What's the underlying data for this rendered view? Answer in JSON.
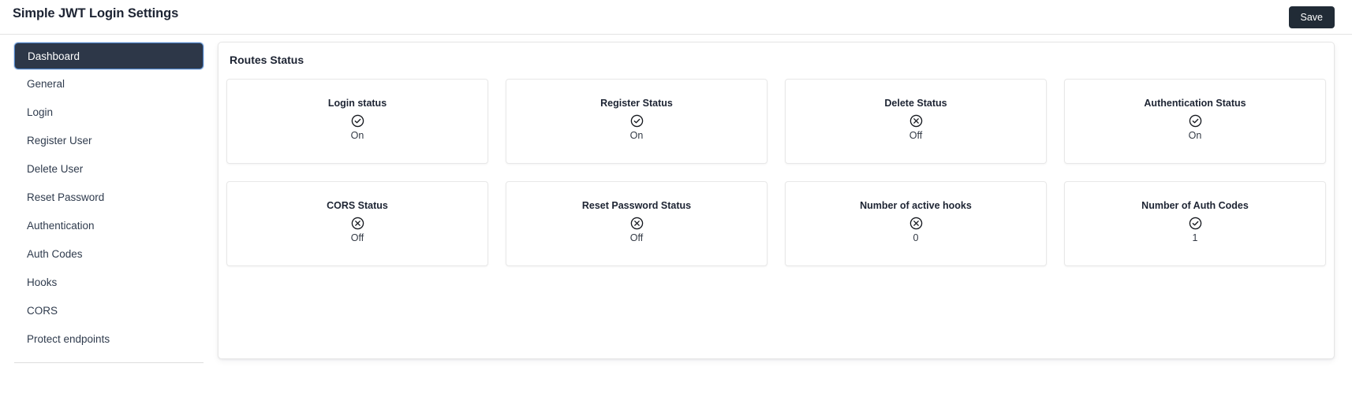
{
  "header": {
    "title": "Simple JWT Login Settings",
    "save_label": "Save"
  },
  "sidebar": {
    "items": [
      {
        "label": "Dashboard",
        "active": true
      },
      {
        "label": "General",
        "active": false
      },
      {
        "label": "Login",
        "active": false
      },
      {
        "label": "Register User",
        "active": false
      },
      {
        "label": "Delete User",
        "active": false
      },
      {
        "label": "Reset Password",
        "active": false
      },
      {
        "label": "Authentication",
        "active": false
      },
      {
        "label": "Auth Codes",
        "active": false
      },
      {
        "label": "Hooks",
        "active": false
      },
      {
        "label": "CORS",
        "active": false
      },
      {
        "label": "Protect endpoints",
        "active": false
      }
    ]
  },
  "main": {
    "panel_title": "Routes Status",
    "cards": [
      {
        "label": "Login status",
        "value": "On",
        "icon": "check-circle-icon"
      },
      {
        "label": "Register Status",
        "value": "On",
        "icon": "check-circle-icon"
      },
      {
        "label": "Delete Status",
        "value": "Off",
        "icon": "x-circle-icon"
      },
      {
        "label": "Authentication Status",
        "value": "On",
        "icon": "check-circle-icon"
      },
      {
        "label": "CORS Status",
        "value": "Off",
        "icon": "x-circle-icon"
      },
      {
        "label": "Reset Password Status",
        "value": "Off",
        "icon": "x-circle-icon"
      },
      {
        "label": "Number of active hooks",
        "value": "0",
        "icon": "x-circle-icon"
      },
      {
        "label": "Number of Auth Codes",
        "value": "1",
        "icon": "check-circle-icon"
      }
    ]
  },
  "colors": {
    "accent_dark": "#2d3748",
    "active_border": "#4b7fc4",
    "text_primary": "#1d2433",
    "save_bg": "#212b36"
  }
}
